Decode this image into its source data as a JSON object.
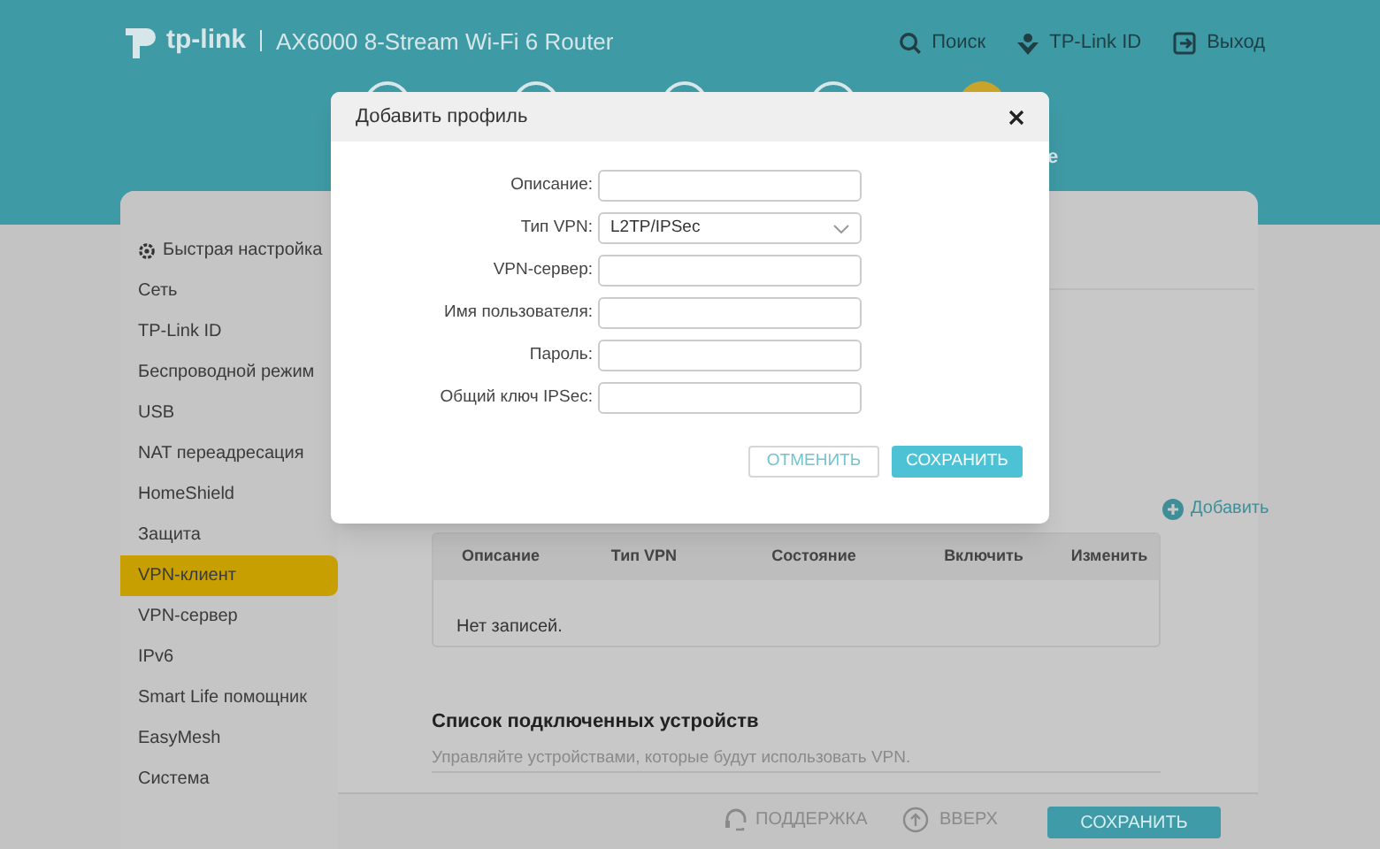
{
  "header": {
    "brand": "tp-link",
    "model": "AX6000 8-Stream Wi-Fi 6 Router",
    "actions": [
      {
        "kind": "search",
        "label": "Поиск"
      },
      {
        "kind": "id",
        "label": "TP-Link ID"
      },
      {
        "kind": "logout",
        "label": "Выход"
      }
    ],
    "nav_steps": [
      {
        "selected": false
      },
      {
        "selected": false
      },
      {
        "selected": false
      },
      {
        "selected": false
      },
      {
        "selected": true
      }
    ],
    "nav_label_fragment": "е"
  },
  "sidebar": {
    "items": [
      {
        "label": "Быстрая настройка",
        "kind": "gear",
        "selected": false
      },
      {
        "label": "Сеть",
        "selected": false
      },
      {
        "label": "TP-Link ID",
        "selected": false
      },
      {
        "label": "Беспроводной режим",
        "selected": false
      },
      {
        "label": "USB",
        "selected": false
      },
      {
        "label": "NAT переадресация",
        "selected": false
      },
      {
        "label": "HomeShield",
        "selected": false
      },
      {
        "label": "Защита",
        "selected": false
      },
      {
        "label": "VPN-клиент",
        "selected": true
      },
      {
        "label": "VPN-сервер",
        "selected": false
      },
      {
        "label": "IPv6",
        "selected": false
      },
      {
        "label": "Smart Life помощник",
        "selected": false
      },
      {
        "label": "EasyMesh",
        "selected": false
      },
      {
        "label": "Система",
        "selected": false
      }
    ]
  },
  "content": {
    "add_link": "Добавить",
    "table": {
      "columns": [
        "Описание",
        "Тип VPN",
        "Состояние",
        "Включить",
        "Изменить"
      ],
      "empty_text": "Нет записей."
    },
    "devices": {
      "title": "Список подключенных устройств",
      "description": "Управляйте устройствами, которые будут использовать VPN."
    }
  },
  "footer": {
    "support": "ПОДДЕРЖКА",
    "top": "ВВЕРХ",
    "save": "СОХРАНИТЬ"
  },
  "dialog": {
    "title": "Добавить профиль",
    "fields": [
      {
        "label": "Описание:",
        "kind": "text"
      },
      {
        "label": "Тип VPN:",
        "kind": "select",
        "value": "L2TP/IPSec"
      },
      {
        "label": "VPN-сервер:",
        "kind": "text"
      },
      {
        "label": "Имя пользователя:",
        "kind": "text"
      },
      {
        "label": "Пароль:",
        "kind": "text"
      },
      {
        "label": "Общий ключ IPSec:",
        "kind": "text"
      }
    ],
    "buttons": [
      {
        "kind": "secondary",
        "label": "ОТМЕНИТЬ"
      },
      {
        "kind": "primary",
        "label": "СОХРАНИТЬ"
      }
    ]
  }
}
